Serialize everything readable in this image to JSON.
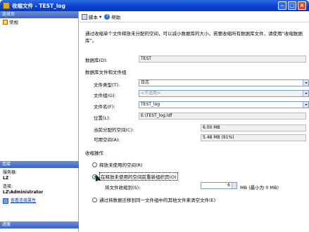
{
  "window": {
    "title": "收缩文件 - TEST_log"
  },
  "left": {
    "select_page_header": "选择页",
    "pages": [
      {
        "label": "常规"
      }
    ],
    "connection_header": "连接",
    "server_label": "服务器:",
    "server_value": "LZ",
    "connection_label": "连接:",
    "connection_value": "LZ\\Administrator",
    "view_conn_link": "查看连接属性",
    "progress_header": "进度"
  },
  "toolbar": {
    "script_label": "脚本",
    "help_label": "帮助"
  },
  "description": "通过收缩单个文件释放未分配的空间，可以减小数据库的大小。若要收缩所有数据库文件，请使用“收缩数据库”。",
  "form": {
    "database_label": "数据库(D):",
    "database_value": "TEST",
    "files_group_title": "数据库文件和文件组",
    "file_type_label": "文件类型(T):",
    "file_type_value": "日志",
    "filegroup_label": "文件组(G):",
    "filegroup_value": "<不适用>",
    "filename_label": "文件名(F):",
    "filename_value": "TEST_log",
    "location_label": "位置(L):",
    "location_value": "E:\\TEST_log.ldf",
    "allocated_label": "当前分配的空间(C):",
    "allocated_value": "6.00 MB",
    "available_label": "可用空间(A):",
    "available_value": "5.48 MB (91%)"
  },
  "shrink": {
    "title": "收缩操作",
    "opt1": "释放未使用的空间(R)",
    "opt2": "在释放未使用的空间前重新组织页(O)",
    "shrink_to_label": "将文件收缩到(S):",
    "shrink_to_value": "6",
    "shrink_unit": "MB (最小为 0 MB)",
    "opt3": "通过将数据迁移到同一文件组中的其他文件来清空文件(E)"
  }
}
